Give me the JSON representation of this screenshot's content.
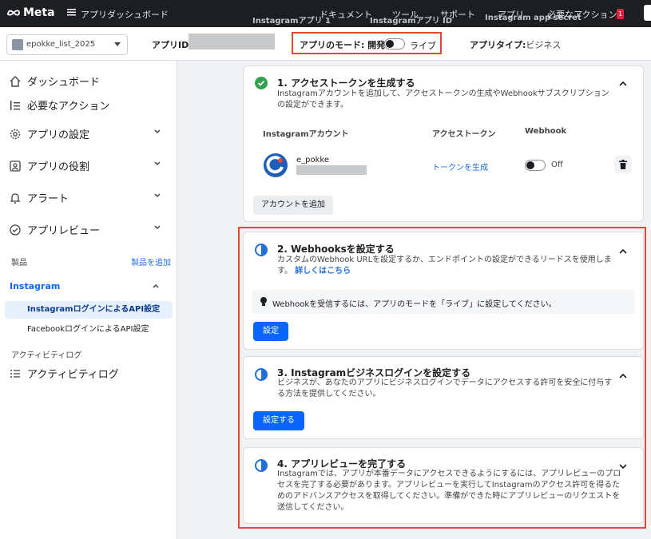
{
  "topnav": {
    "logo": "Meta",
    "app_dashboard": "アプリダッシュボード",
    "docs": "ドキュメント",
    "tools": "ツール",
    "support": "サポート",
    "apps": "アプリ",
    "required_actions": "必要なアクション",
    "required_actions_count": "1",
    "ghost_left": "Instagramアプリ 1",
    "ghost_mid": "Instagramアプリ ID",
    "ghost_right": "Instagram app secret"
  },
  "subbar": {
    "app_name": "epokke_list_2025",
    "app_id_label": "アプリID:",
    "mode_label": "アプリのモード: 開発",
    "mode_live": "ライブ",
    "app_type_label": "アプリタイプ:",
    "app_type_value": "ビジネス"
  },
  "sidebar": {
    "dashboard": "ダッシュボード",
    "required_actions": "必要なアクション",
    "app_settings": "アプリの設定",
    "app_roles": "アプリの役割",
    "alerts": "アラート",
    "app_review": "アプリレビュー",
    "products": "製品",
    "add_product": "製品を追加",
    "instagram": "Instagram",
    "ig_login_api": "InstagramログインによるAPI設定",
    "fb_login_api": "FacebookログインによるAPI設定",
    "activity_log_section": "アクティビティログ",
    "activity_log": "アクティビティログ"
  },
  "cards": {
    "step1": {
      "title": "1. アクセストークンを生成する",
      "desc": "Instagramアカウントを追加して、アクセストークンの生成やWebhookサブスクリプションの設定ができます。",
      "col_account": "Instagramアカウント",
      "col_token": "アクセストークン",
      "col_webhook": "Webhook",
      "account_name": "e_pokke",
      "token_link": "トークンを生成",
      "webhook_state": "Off",
      "add_account": "アカウントを追加"
    },
    "step2": {
      "title": "2. Webhooksを設定する",
      "desc": "カスタムのWebhook URLを設定するか、エンドポイントの設定ができるリードスを使用します。",
      "link": "詳しくはこちら",
      "hint": "Webhookを受信するには、アプリのモードを「ライブ」に設定してください。",
      "button": "設定"
    },
    "step3": {
      "title": "3. Instagramビジネスログインを設定する",
      "desc": "ビジネスが、あなたのアプリにビジネスログインでデータにアクセスする許可を安全に付与する方法を提供してください。",
      "button": "設定する"
    },
    "step4": {
      "title": "4. アプリレビューを完了する",
      "desc": "Instagramでは、アプリが本番データにアクセスできるようにするには、アプリレビューのプロセスを完了する必要があります。アプリレビューを実行してInstagramのアクセス許可を得るためのアドバンスアクセスを取得してください。準備ができた時にアプリレビューのリクエストを送信してください。"
    }
  },
  "colors": {
    "accent": "#0866ff",
    "highlight_outline": "#e8472f",
    "success": "#31a24c"
  }
}
